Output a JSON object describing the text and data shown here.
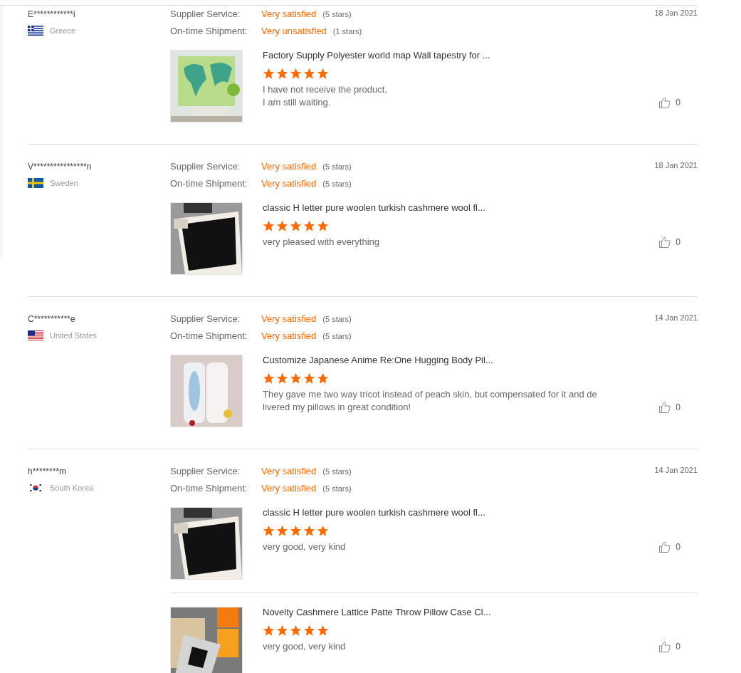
{
  "reviews": [
    {
      "user": "E************i",
      "country": "Greece",
      "flag": {
        "kind": "greece"
      },
      "date": "18 Jan 2021",
      "ratings": [
        {
          "label": "Supplier Service:",
          "value": "Very satisfied",
          "count": "(5 stars)"
        },
        {
          "label": "On-time Shipment:",
          "value": "Very unsatisfied",
          "count": "(1 stars)"
        }
      ],
      "products": [
        {
          "title": "Factory Supply Polyester world map Wall tapestry for ...",
          "stars": 5,
          "text": [
            "I have not receive the product.",
            "I am still waiting."
          ],
          "likes": "0",
          "image": {
            "kind": "picture"
          }
        }
      ]
    },
    {
      "user": "V****************n",
      "country": "Sweden",
      "flag": {
        "kind": "sweden"
      },
      "date": "18 Jan 2021",
      "ratings": [
        {
          "label": "Supplier Service:",
          "value": "Very satisfied",
          "count": "(5 stars)"
        },
        {
          "label": "On-time Shipment:",
          "value": "Very satisfied",
          "count": "(5 stars)"
        }
      ],
      "products": [
        {
          "title": "classic H letter pure woolen turkish cashmere wool fl...",
          "stars": 5,
          "text": [
            "very pleased with everything"
          ],
          "likes": "0",
          "image": {
            "kind": "picture"
          }
        }
      ]
    },
    {
      "user": "C***********e",
      "country": "United States",
      "flag": {
        "kind": "usa"
      },
      "date": "14 Jan 2021",
      "ratings": [
        {
          "label": "Supplier Service:",
          "value": "Very satisfied",
          "count": "(5 stars)"
        },
        {
          "label": "On-time Shipment:",
          "value": "Very satisfied",
          "count": "(5 stars)"
        }
      ],
      "products": [
        {
          "title": "Customize Japanese Anime Re:One Hugging Body Pil...",
          "stars": 5,
          "text": [
            "They gave me two way tricot instead of peach skin, but compensated for it and de",
            "livered my pillows in great condition!"
          ],
          "likes": "0",
          "image": {
            "kind": "picture"
          }
        }
      ]
    },
    {
      "user": "h********m",
      "country": "South Korea",
      "flag": {
        "kind": "korea"
      },
      "date": "14 Jan 2021",
      "ratings": [
        {
          "label": "Supplier Service:",
          "value": "Very satisfied",
          "count": "(5 stars)"
        },
        {
          "label": "On-time Shipment:",
          "value": "Very satisfied",
          "count": "(5 stars)"
        }
      ],
      "products": [
        {
          "title": "classic H letter pure woolen turkish cashmere wool fl...",
          "stars": 5,
          "text": [
            "very good, very kind"
          ],
          "likes": "0",
          "image": {
            "kind": "picture"
          }
        },
        {
          "title": "Novelty Cashmere Lattice Patte Throw Pillow Case Cl...",
          "stars": 5,
          "text": [
            "very good, very kind"
          ],
          "likes": "0",
          "image": {
            "kind": "picture"
          }
        }
      ]
    }
  ]
}
